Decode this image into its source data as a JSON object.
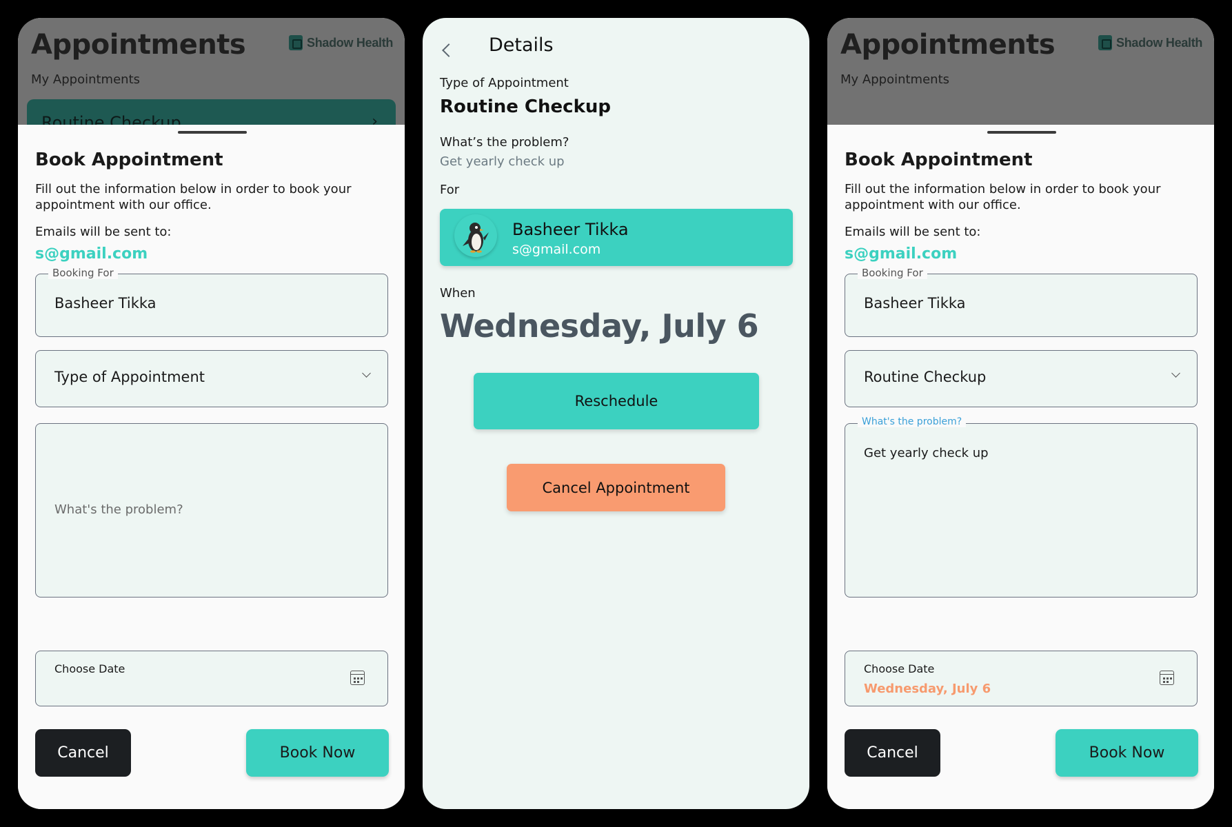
{
  "background": {
    "title": "Appointments",
    "subtitle": "My Appointments",
    "logo_text": "Shadow Health",
    "card_label": "Routine Checkup"
  },
  "sheet": {
    "title": "Book Appointment",
    "description": "Fill out the information below in order to book your appointment with our office.",
    "emails_label": "Emails will be sent to:",
    "email": "s@gmail.com",
    "booking_for_label": "Booking For",
    "booking_for_value": "Basheer Tikka",
    "type_placeholder": "Type of Appointment",
    "problem_placeholder": "What's the problem?",
    "choose_date_label": "Choose Date",
    "cancel_label": "Cancel",
    "book_label": "Book Now"
  },
  "filled": {
    "type_value": "Routine Checkup",
    "problem_label": "What's the problem?",
    "problem_value": "Get yearly check up",
    "date_value": "Wednesday, July 6"
  },
  "details": {
    "title": "Details",
    "type_label": "Type of Appointment",
    "type_value": "Routine Checkup",
    "problem_label": "What’s the problem?",
    "problem_value": "Get yearly check up",
    "for_label": "For",
    "patient_name": "Basheer Tikka",
    "patient_email": "s@gmail.com",
    "when_label": "When",
    "when_value": "Wednesday, July 6",
    "reschedule_label": "Reschedule",
    "cancel_appt_label": "Cancel Appointment"
  },
  "colors": {
    "accent_teal": "#3cd1c0",
    "accent_orange": "#f99b70",
    "dark_button": "#1c1f22"
  }
}
